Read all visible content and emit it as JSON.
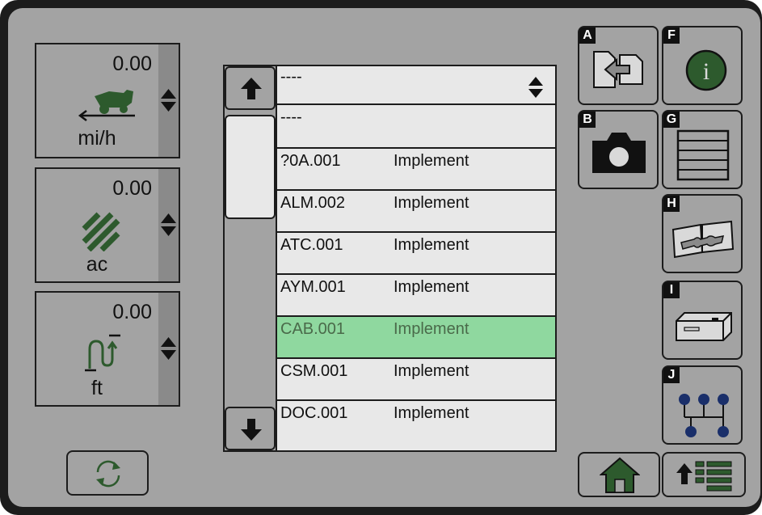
{
  "readouts": [
    {
      "value": "0.00",
      "unit": "mi/h",
      "icon": "speed-harvester-icon"
    },
    {
      "value": "0.00",
      "unit": "ac",
      "icon": "area-hatch-icon"
    },
    {
      "value": "0.00",
      "unit": "ft",
      "icon": "distance-lift-icon"
    }
  ],
  "dropdown": {
    "selected": "----"
  },
  "list": [
    {
      "code": "----",
      "type": ""
    },
    {
      "code": "?0A.001",
      "type": "Implement"
    },
    {
      "code": "ALM.002",
      "type": "Implement"
    },
    {
      "code": "ATC.001",
      "type": "Implement"
    },
    {
      "code": "AYM.001",
      "type": "Implement"
    },
    {
      "code": "CAB.001",
      "type": "Implement"
    },
    {
      "code": "CSM.001",
      "type": "Implement"
    },
    {
      "code": "DOC.001",
      "type": "Implement"
    }
  ],
  "right_buttons": [
    {
      "letter": "A",
      "icon": "file-transfer-icon"
    },
    {
      "letter": "B",
      "icon": "camera-icon"
    },
    {
      "letter": "F",
      "icon": "info-icon",
      "glyph": "i"
    },
    {
      "letter": "G",
      "icon": "list-view-icon"
    },
    {
      "letter": "H",
      "icon": "service-manual-icon"
    },
    {
      "letter": "I",
      "icon": "controller-box-icon"
    },
    {
      "letter": "J",
      "icon": "network-diagram-icon"
    }
  ],
  "colors": {
    "background": "#a3a3a3",
    "accent_green": "#2d5a2d",
    "selected_row": "#8fd89f"
  }
}
